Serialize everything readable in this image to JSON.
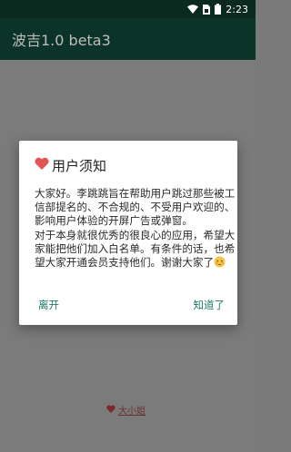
{
  "status_bar": {
    "time": "2:23",
    "icons": [
      "wifi-icon",
      "sim-icon",
      "battery-icon"
    ]
  },
  "app_bar": {
    "title": "波吉1.0 beta3"
  },
  "dialog": {
    "title": "用户须知",
    "title_icon": "heart-icon",
    "paragraph_1": "大家好。李跳跳旨在帮助用户跳过那些被工信部提名的、不合规的、不受用户欢迎的、影响用户体验的开屏广告或弹窗。",
    "paragraph_2_text": "对于本身就很优秀的很良心的应用，希望大家能把他们加入白名单。有条件的话，也希望大家开通会员支持他们。谢谢大家了",
    "paragraph_2_emoji": "blushing-face-icon",
    "leave_button": "离开",
    "ok_button": "知道了"
  },
  "footer_link": {
    "label": "大小姐",
    "icon": "heart-icon"
  },
  "colors": {
    "status_bar": "#0a2a20",
    "app_bar": "#0c3328",
    "accent": "#1e7a6a",
    "heart": "#e25555"
  }
}
